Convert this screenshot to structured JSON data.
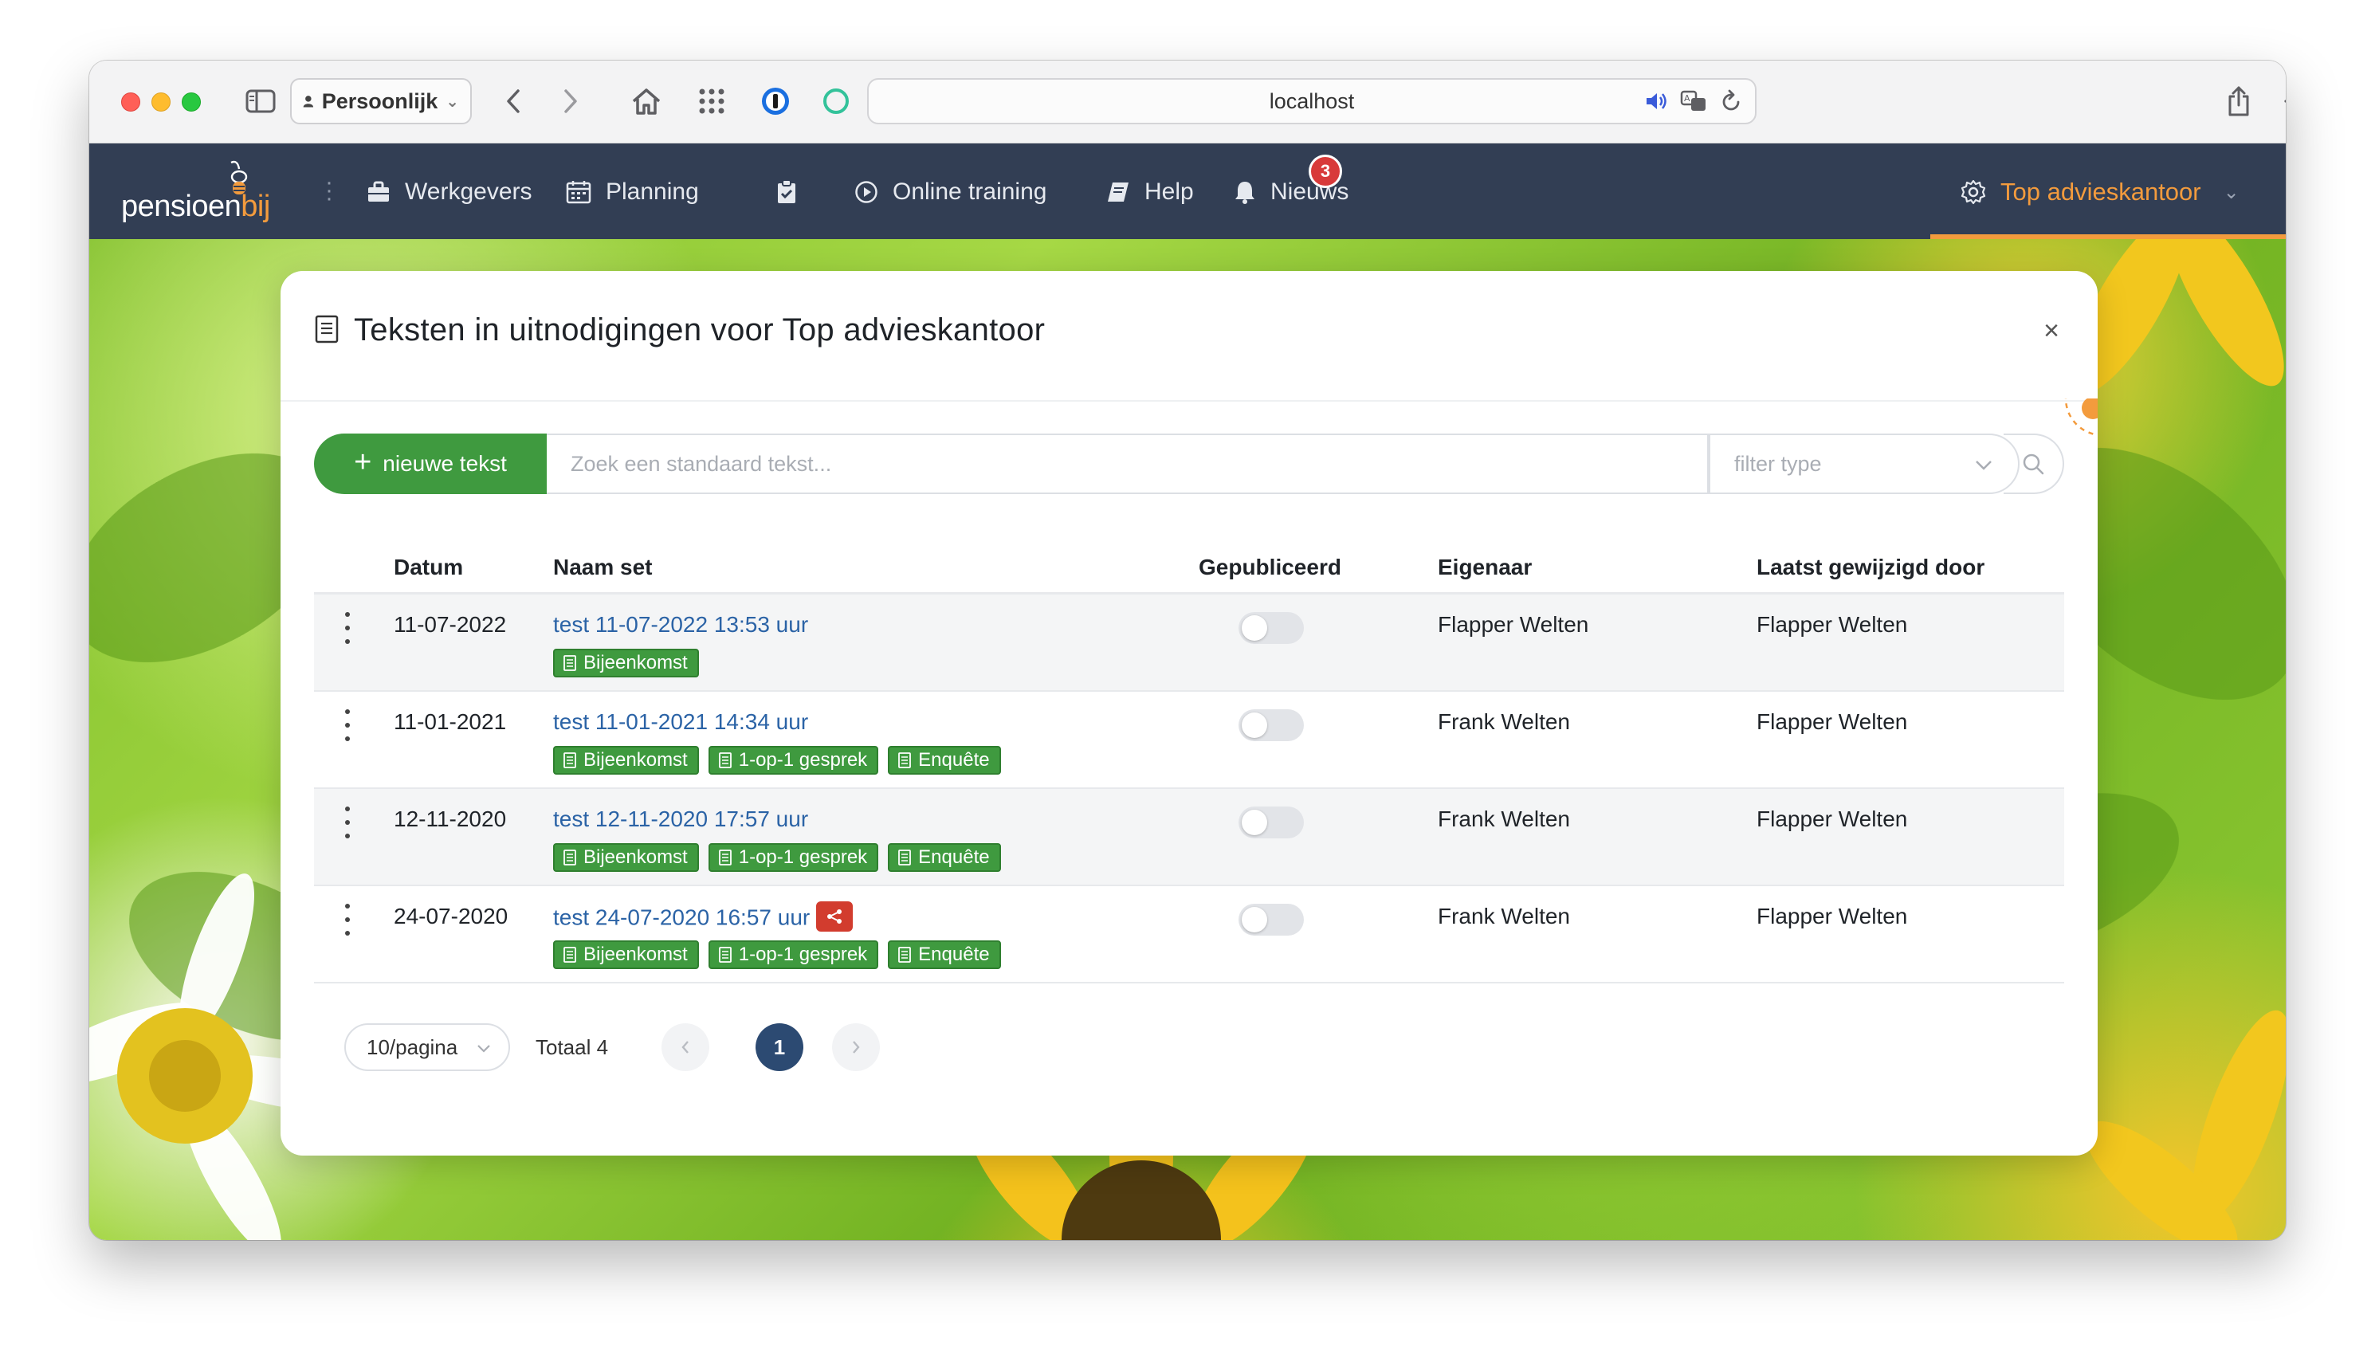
{
  "browser": {
    "profile": "Persoonlijk",
    "url": "localhost"
  },
  "nav": {
    "logo_main": "pensioen",
    "logo_accent": "bij",
    "items": [
      {
        "label": "Werkgevers",
        "icon": "briefcase-icon"
      },
      {
        "label": "Planning",
        "icon": "calendar-icon"
      },
      {
        "label": "",
        "icon": "clipboard-check-icon"
      },
      {
        "label": "Online training",
        "icon": "play-circle-icon"
      },
      {
        "label": "Help",
        "icon": "book-icon"
      },
      {
        "label": "Nieuws",
        "icon": "bell-icon"
      }
    ],
    "news_count": "3",
    "organisation": "Top advieskantoor",
    "accent_color": "#f39b3d"
  },
  "modal": {
    "title": "Teksten in uitnodigingen voor Top advieskantoor",
    "close": "×",
    "new_button": "nieuwe tekst",
    "search_placeholder": "Zoek een standaard tekst...",
    "filter_placeholder": "filter type"
  },
  "table": {
    "columns": [
      "Datum",
      "Naam set",
      "Gepubliceerd",
      "Eigenaar",
      "Laatst gewijzigd door"
    ],
    "rows": [
      {
        "date": "11-07-2022",
        "name": "test 11-07-2022 13:53 uur",
        "shared": false,
        "tags": [
          "Bijeenkomst"
        ],
        "published": false,
        "owner": "Flapper Welten",
        "modified_by": "Flapper Welten"
      },
      {
        "date": "11-01-2021",
        "name": "test 11-01-2021 14:34 uur",
        "shared": false,
        "tags": [
          "Bijeenkomst",
          "1-op-1 gesprek",
          "Enquête"
        ],
        "published": false,
        "owner": "Frank Welten",
        "modified_by": "Flapper Welten"
      },
      {
        "date": "12-11-2020",
        "name": "test 12-11-2020 17:57 uur",
        "shared": false,
        "tags": [
          "Bijeenkomst",
          "1-op-1 gesprek",
          "Enquête"
        ],
        "published": false,
        "owner": "Frank Welten",
        "modified_by": "Flapper Welten"
      },
      {
        "date": "24-07-2020",
        "name": "test 24-07-2020 16:57 uur",
        "shared": true,
        "tags": [
          "Bijeenkomst",
          "1-op-1 gesprek",
          "Enquête"
        ],
        "published": false,
        "owner": "Frank Welten",
        "modified_by": "Flapper Welten"
      }
    ]
  },
  "pager": {
    "page_size": "10/pagina",
    "total": "Totaal 4",
    "current_page": "1"
  },
  "colors": {
    "tag_green": "#3f9a3f",
    "link_blue": "#2b63a6",
    "navbar": "#323e54",
    "pager_active": "#2c4a72",
    "share_red": "#d23c2e"
  }
}
